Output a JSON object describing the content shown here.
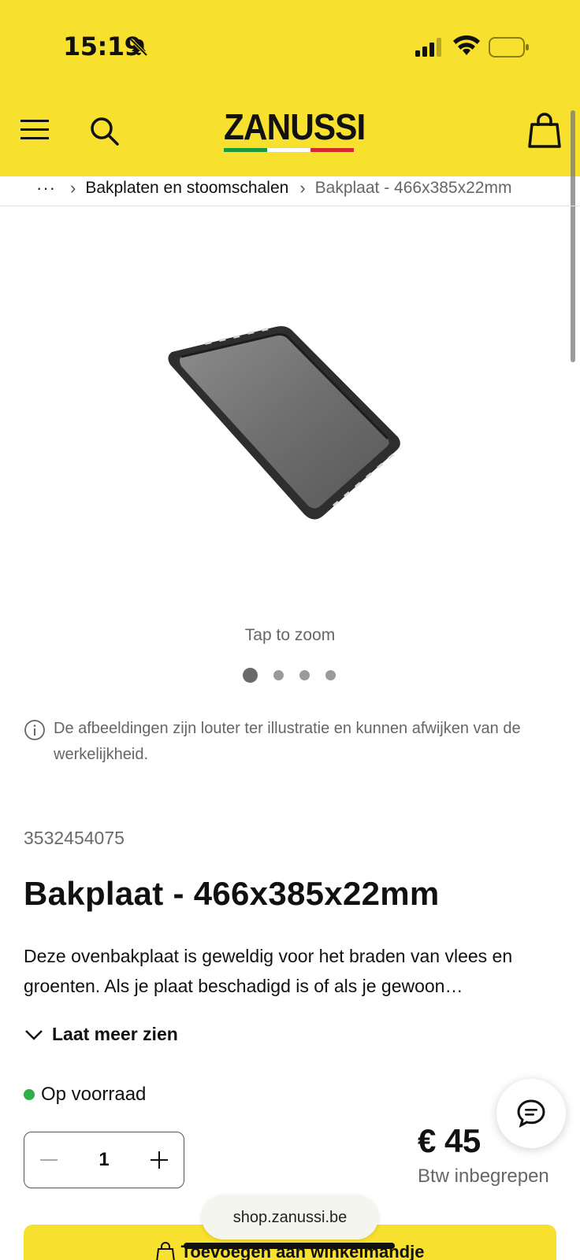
{
  "status_bar": {
    "time": "15:19"
  },
  "header": {
    "brand": "ZANUSSI",
    "brand_colors": [
      "#1a9a3a",
      "#ffffff",
      "#d42a2a"
    ]
  },
  "breadcrumb": {
    "items": [
      "Bakplaten en stoomschalen"
    ],
    "current": "Bakplaat - 466x385x22mm"
  },
  "gallery": {
    "tap_to_zoom": "Tap to zoom",
    "image_count": 4,
    "active_index": 0
  },
  "disclaimer": "De afbeeldingen zijn louter ter illustratie en kunnen afwijken van de werkelijkheid.",
  "product": {
    "sku": "3532454075",
    "title": "Bakplaat - 466x385x22mm",
    "description": "Deze ovenbakplaat is geweldig voor het braden van vlees en groenten. Als je plaat beschadigd is of als je gewoon…",
    "show_more": "Laat meer zien",
    "stock": "Op voorraad",
    "quantity": "1",
    "price": "€ 45",
    "vat_note": "Btw inbegrepen",
    "add_to_cart": "Toevoegen aan winkelmandje"
  },
  "browser": {
    "url": "shop.zanussi.be"
  },
  "colors": {
    "accent": "#f7e02e",
    "in_stock": "#2fae4a"
  }
}
